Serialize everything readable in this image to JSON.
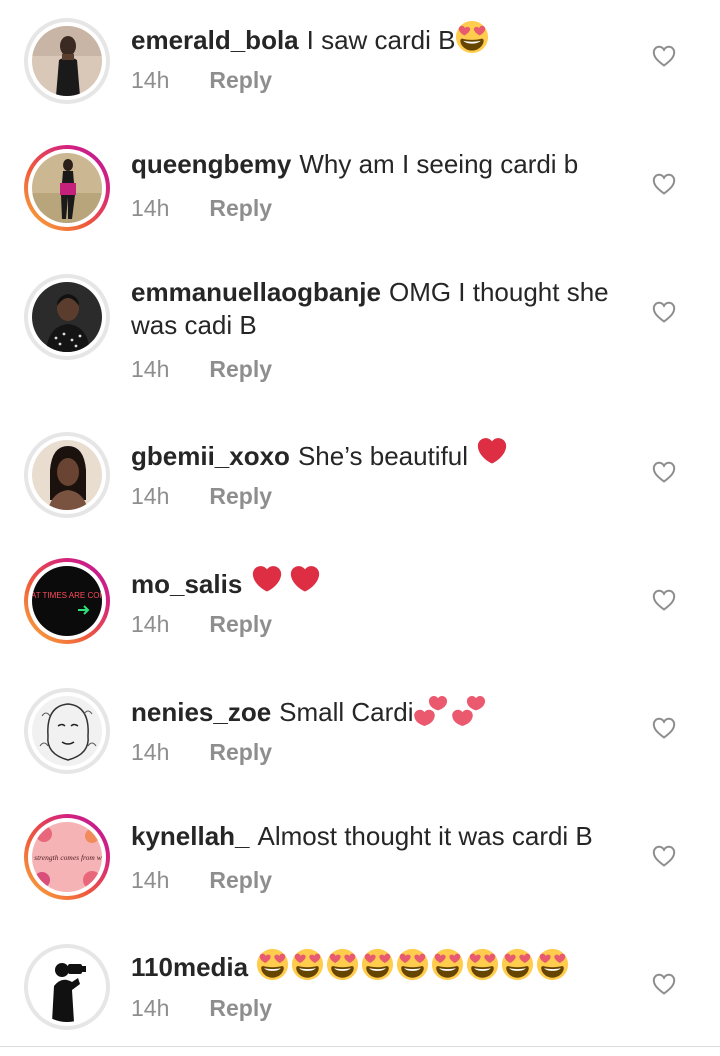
{
  "comments": [
    {
      "username": "emerald_bola",
      "text": "I saw cardi B",
      "emojis": [
        "heart-eyes"
      ],
      "time": "14h",
      "reply": "Reply"
    },
    {
      "username": "queengbemy",
      "text": "Why am I seeing cardi b",
      "emojis": [],
      "time": "14h",
      "reply": "Reply"
    },
    {
      "username": "emmanuellaogbanje",
      "text": "OMG I thought she was cadi B",
      "emojis": [],
      "time": "14h",
      "reply": "Reply"
    },
    {
      "username": "gbemii_xoxo",
      "text": "She’s beautiful ",
      "emojis": [
        "red-heart"
      ],
      "time": "14h",
      "reply": "Reply"
    },
    {
      "username": "mo_salis",
      "text": "",
      "emojis": [
        "red-heart",
        "red-heart"
      ],
      "time": "14h",
      "reply": "Reply"
    },
    {
      "username": "nenies_zoe",
      "text": "Small Cardi",
      "emojis": [
        "two-hearts",
        "two-hearts"
      ],
      "time": "14h",
      "reply": "Reply"
    },
    {
      "username": "kynellah_",
      "text": "Almost thought it was cardi B",
      "emojis": [],
      "time": "14h",
      "reply": "Reply"
    },
    {
      "username": "110media",
      "text": "",
      "emojis": [
        "heart-eyes",
        "heart-eyes",
        "heart-eyes",
        "heart-eyes",
        "heart-eyes",
        "heart-eyes",
        "heart-eyes",
        "heart-eyes",
        "heart-eyes"
      ],
      "time": "14h",
      "reply": "Reply"
    }
  ],
  "avatars": {
    "3": {
      "text": "GREAT TIMES ARE COMING"
    },
    "6": {
      "text": "True strength comes from within"
    }
  },
  "colors": {
    "text": "#262626",
    "meta": "#8e8e8e",
    "like_icon": "#8e8e8e",
    "story_ring_start": "#f8b23b",
    "story_ring_end": "#b31ba0"
  }
}
